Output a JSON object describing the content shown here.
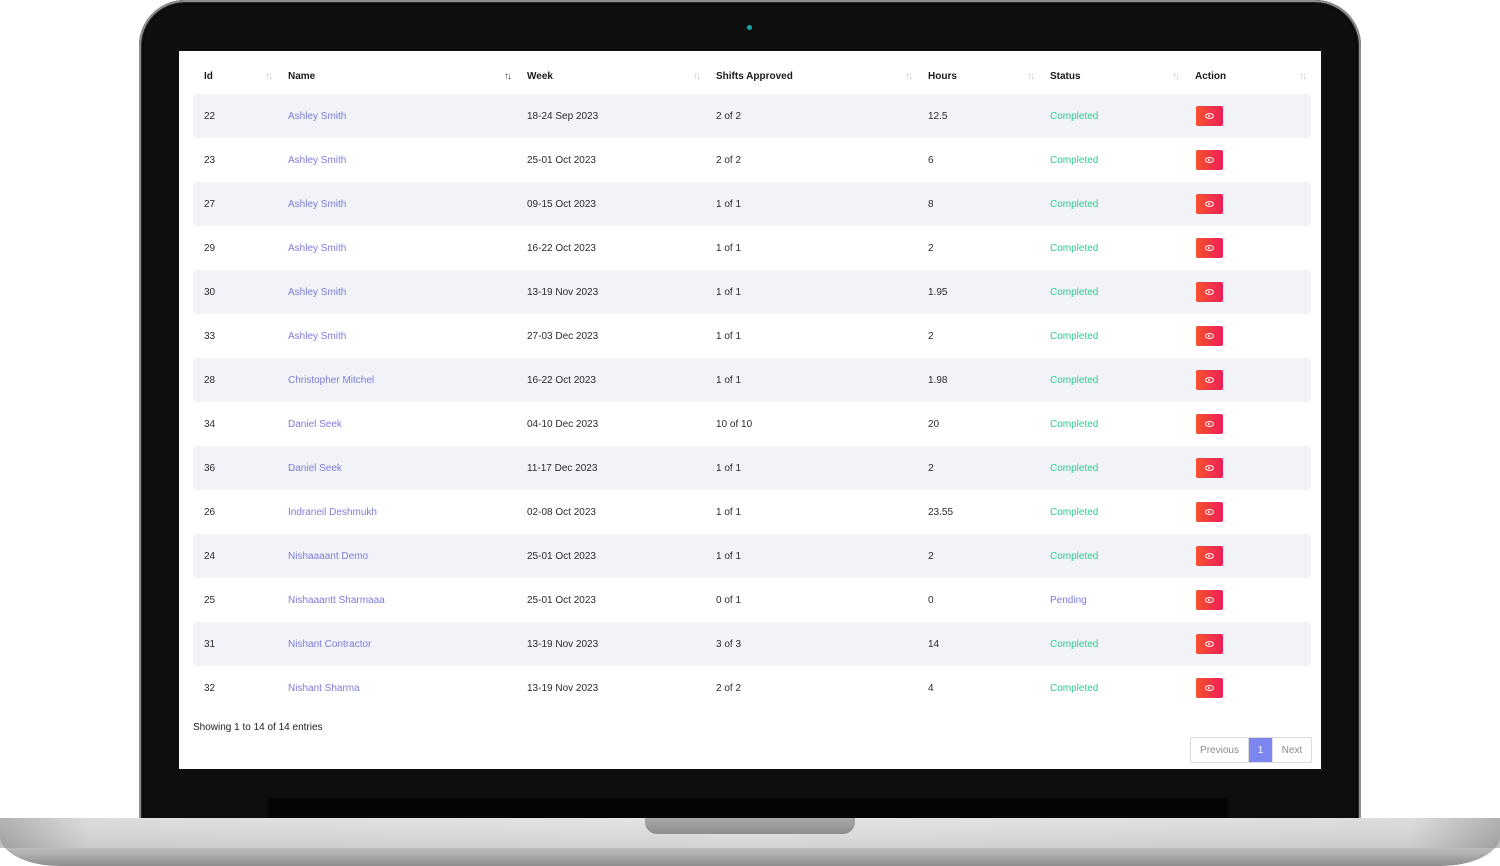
{
  "table": {
    "columns": [
      "Id",
      "Name",
      "Week",
      "Shifts Approved",
      "Hours",
      "Status",
      "Action"
    ],
    "rows": [
      {
        "id": "22",
        "name": "Ashley Smith",
        "week": "18-24 Sep 2023",
        "shifts": "2 of 2",
        "hours": "12.5",
        "status": "Completed"
      },
      {
        "id": "23",
        "name": "Ashley Smith",
        "week": "25-01 Oct 2023",
        "shifts": "2 of 2",
        "hours": "6",
        "status": "Completed"
      },
      {
        "id": "27",
        "name": "Ashley Smith",
        "week": "09-15 Oct 2023",
        "shifts": "1 of 1",
        "hours": "8",
        "status": "Completed"
      },
      {
        "id": "29",
        "name": "Ashley Smith",
        "week": "16-22 Oct 2023",
        "shifts": "1 of 1",
        "hours": "2",
        "status": "Completed"
      },
      {
        "id": "30",
        "name": "Ashley Smith",
        "week": "13-19 Nov 2023",
        "shifts": "1 of 1",
        "hours": "1.95",
        "status": "Completed"
      },
      {
        "id": "33",
        "name": "Ashley Smith",
        "week": "27-03 Dec 2023",
        "shifts": "1 of 1",
        "hours": "2",
        "status": "Completed"
      },
      {
        "id": "28",
        "name": "Christopher Mitchel",
        "week": "16-22 Oct 2023",
        "shifts": "1 of 1",
        "hours": "1.98",
        "status": "Completed"
      },
      {
        "id": "34",
        "name": "Daniel Seek",
        "week": "04-10 Dec 2023",
        "shifts": "10 of 10",
        "hours": "20",
        "status": "Completed"
      },
      {
        "id": "36",
        "name": "Daniel Seek",
        "week": "11-17 Dec 2023",
        "shifts": "1 of 1",
        "hours": "2",
        "status": "Completed"
      },
      {
        "id": "26",
        "name": "Indraneil Deshmukh",
        "week": "02-08 Oct 2023",
        "shifts": "1 of 1",
        "hours": "23.55",
        "status": "Completed"
      },
      {
        "id": "24",
        "name": "Nishaaaant Demo",
        "week": "25-01 Oct 2023",
        "shifts": "1 of 1",
        "hours": "2",
        "status": "Completed"
      },
      {
        "id": "25",
        "name": "Nishaaantt Sharmaaa",
        "week": "25-01 Oct 2023",
        "shifts": "0 of 1",
        "hours": "0",
        "status": "Pending"
      },
      {
        "id": "31",
        "name": "Nishant Contractor",
        "week": "13-19 Nov 2023",
        "shifts": "3 of 3",
        "hours": "14",
        "status": "Completed"
      },
      {
        "id": "32",
        "name": "Nishant Sharma",
        "week": "13-19 Nov 2023",
        "shifts": "2 of 2",
        "hours": "4",
        "status": "Completed"
      }
    ],
    "action_icon": "eye-icon",
    "sort_icon": "sort-arrows-icon"
  },
  "footer": {
    "info": "Showing 1 to 14 of 14 entries",
    "prev_label": "Previous",
    "page_label": "1",
    "next_label": "Next"
  },
  "colors": {
    "accent": "#7d85f0",
    "link": "#7b7dd8",
    "completed": "#2ecc8f",
    "action_start": "#f5522d",
    "action_end": "#ec1f5a",
    "stripe": "#f2f3f8"
  }
}
